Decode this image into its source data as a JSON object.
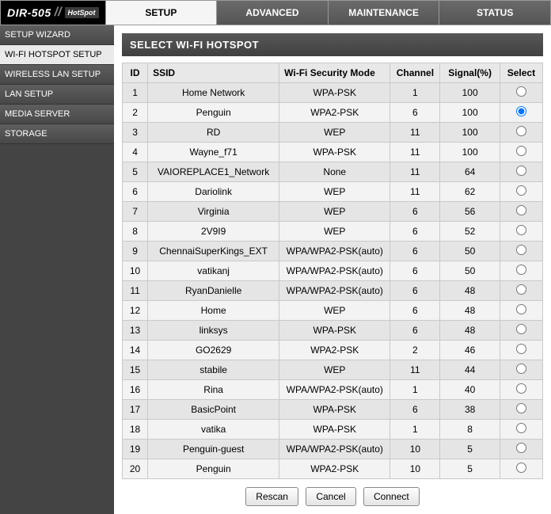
{
  "brand": {
    "model": "DIR-505",
    "mode": "HotSpot"
  },
  "topnav": [
    {
      "label": "SETUP",
      "active": true
    },
    {
      "label": "ADVANCED",
      "active": false
    },
    {
      "label": "MAINTENANCE",
      "active": false
    },
    {
      "label": "STATUS",
      "active": false
    }
  ],
  "sidebar": [
    {
      "label": "SETUP WIZARD",
      "active": false
    },
    {
      "label": "WI-FI HOTSPOT SETUP",
      "active": true
    },
    {
      "label": "WIRELESS LAN SETUP",
      "active": false
    },
    {
      "label": "LAN SETUP",
      "active": false
    },
    {
      "label": "MEDIA SERVER",
      "active": false
    },
    {
      "label": "STORAGE",
      "active": false
    }
  ],
  "panel": {
    "title": "SELECT WI-FI HOTSPOT"
  },
  "columns": {
    "id": "ID",
    "ssid": "SSID",
    "security": "Wi-Fi Security Mode",
    "channel": "Channel",
    "signal": "Signal(%)",
    "select": "Select"
  },
  "selected_index": 1,
  "networks": [
    {
      "id": 1,
      "ssid": "Home Network",
      "security": "WPA-PSK",
      "channel": 1,
      "signal": 100
    },
    {
      "id": 2,
      "ssid": "Penguin",
      "security": "WPA2-PSK",
      "channel": 6,
      "signal": 100
    },
    {
      "id": 3,
      "ssid": "RD",
      "security": "WEP",
      "channel": 11,
      "signal": 100
    },
    {
      "id": 4,
      "ssid": "Wayne_f71",
      "security": "WPA-PSK",
      "channel": 11,
      "signal": 100
    },
    {
      "id": 5,
      "ssid": "VAIOREPLACE1_Network",
      "security": "None",
      "channel": 11,
      "signal": 64
    },
    {
      "id": 6,
      "ssid": "Dariolink",
      "security": "WEP",
      "channel": 11,
      "signal": 62
    },
    {
      "id": 7,
      "ssid": "Virginia",
      "security": "WEP",
      "channel": 6,
      "signal": 56
    },
    {
      "id": 8,
      "ssid": "2V9I9",
      "security": "WEP",
      "channel": 6,
      "signal": 52
    },
    {
      "id": 9,
      "ssid": "ChennaiSuperKings_EXT",
      "security": "WPA/WPA2-PSK(auto)",
      "channel": 6,
      "signal": 50
    },
    {
      "id": 10,
      "ssid": "vatikanj",
      "security": "WPA/WPA2-PSK(auto)",
      "channel": 6,
      "signal": 50
    },
    {
      "id": 11,
      "ssid": "RyanDanielle",
      "security": "WPA/WPA2-PSK(auto)",
      "channel": 6,
      "signal": 48
    },
    {
      "id": 12,
      "ssid": "Home",
      "security": "WEP",
      "channel": 6,
      "signal": 48
    },
    {
      "id": 13,
      "ssid": "linksys",
      "security": "WPA-PSK",
      "channel": 6,
      "signal": 48
    },
    {
      "id": 14,
      "ssid": "GO2629",
      "security": "WPA2-PSK",
      "channel": 2,
      "signal": 46
    },
    {
      "id": 15,
      "ssid": "stabile",
      "security": "WEP",
      "channel": 11,
      "signal": 44
    },
    {
      "id": 16,
      "ssid": "Rina",
      "security": "WPA/WPA2-PSK(auto)",
      "channel": 1,
      "signal": 40
    },
    {
      "id": 17,
      "ssid": "BasicPoint",
      "security": "WPA-PSK",
      "channel": 6,
      "signal": 38
    },
    {
      "id": 18,
      "ssid": "vatika",
      "security": "WPA-PSK",
      "channel": 1,
      "signal": 8
    },
    {
      "id": 19,
      "ssid": "Penguin-guest",
      "security": "WPA/WPA2-PSK(auto)",
      "channel": 10,
      "signal": 5
    },
    {
      "id": 20,
      "ssid": "Penguin",
      "security": "WPA2-PSK",
      "channel": 10,
      "signal": 5
    }
  ],
  "actions": {
    "rescan": "Rescan",
    "cancel": "Cancel",
    "connect": "Connect"
  }
}
